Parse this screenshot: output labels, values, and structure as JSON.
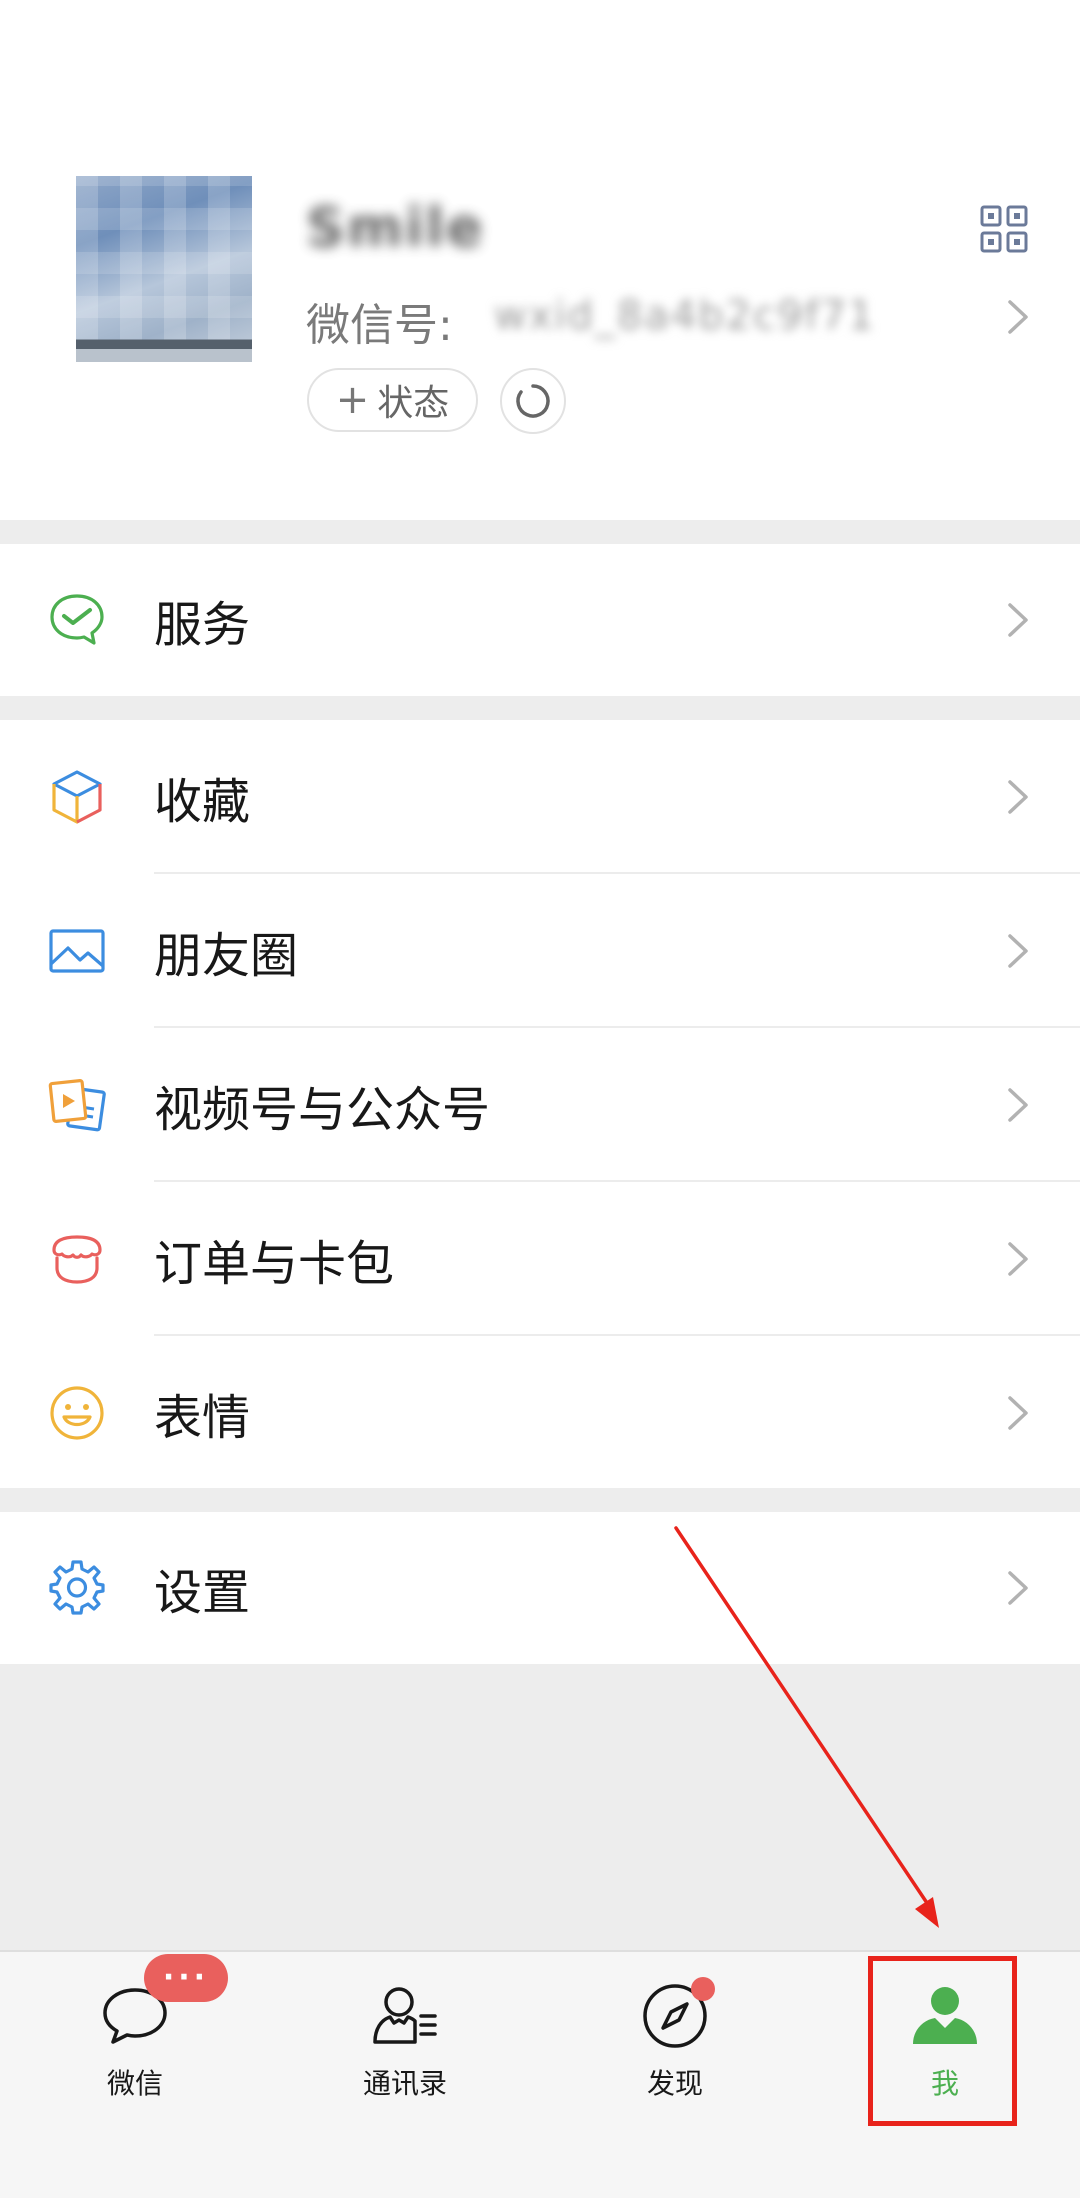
{
  "profile": {
    "nickname": "Smile",
    "wechat_id_label": "微信号:",
    "wechat_id_value": "wxid_8a4b2c9f71",
    "status_label": "状态"
  },
  "menu": {
    "services": "服务",
    "favorites": "收藏",
    "moments": "朋友圈",
    "channels": "视频号与公众号",
    "orders": "订单与卡包",
    "stickers": "表情",
    "settings": "设置"
  },
  "tabbar": {
    "chats": "微信",
    "contacts": "通讯录",
    "discover": "发现",
    "me": "我",
    "chats_badge": "···"
  },
  "colors": {
    "accent_green": "#4caf50",
    "badge_red": "#e9605d",
    "annotation_red": "#e8231b",
    "background": "#ededed"
  },
  "icons": {
    "services": "wechat-pay-check-icon",
    "favorites": "cube-icon",
    "moments": "image-icon",
    "channels": "video-play-icon",
    "orders": "wallet-icon",
    "stickers": "smiley-icon",
    "settings": "gear-icon"
  }
}
